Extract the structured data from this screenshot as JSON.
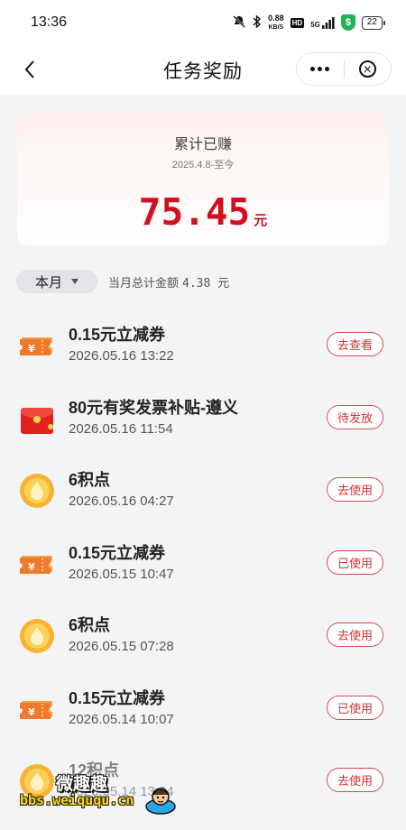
{
  "status_bar": {
    "time": "13:36",
    "net_speed_top": "0.88",
    "net_speed_unit": "KB/S",
    "hd": "HD",
    "signal": "5G",
    "battery": "22"
  },
  "nav": {
    "title": "任务奖励"
  },
  "summary": {
    "label": "累计已赚",
    "range": "2025.4.8-至今",
    "amount": "75.45",
    "unit": "元"
  },
  "filter": {
    "month_label": "本月",
    "total_label": "当月总计金额",
    "total_value": "4.38 元"
  },
  "items": [
    {
      "icon": "coupon-icon",
      "title": "0.15元立减券",
      "time": "2026.05.16 13:22",
      "action": "去查看"
    },
    {
      "icon": "red-envelope-icon",
      "title": "80元有奖发票补贴-遵义",
      "time": "2026.05.16 11:54",
      "action": "待发放"
    },
    {
      "icon": "coin-points-icon",
      "title": "6积点",
      "time": "2026.05.16 04:27",
      "action": "去使用"
    },
    {
      "icon": "coupon-icon",
      "title": "0.15元立减券",
      "time": "2026.05.15 10:47",
      "action": "已使用"
    },
    {
      "icon": "coin-points-icon",
      "title": "6积点",
      "time": "2026.05.15 07:28",
      "action": "去使用"
    },
    {
      "icon": "coupon-icon",
      "title": "0.15元立减券",
      "time": "2026.05.14 10:07",
      "action": "已使用"
    },
    {
      "icon": "coin-points-icon",
      "title": "12积点",
      "time": "2026.05.14 13:04",
      "action": "去使用"
    }
  ],
  "watermark": {
    "top": "微趣趣",
    "bottom": "bbs.weiququ.cn"
  },
  "colors": {
    "accent_red": "#d20f1f",
    "button_border": "#d84a4a",
    "background": "#f3f4f6"
  }
}
